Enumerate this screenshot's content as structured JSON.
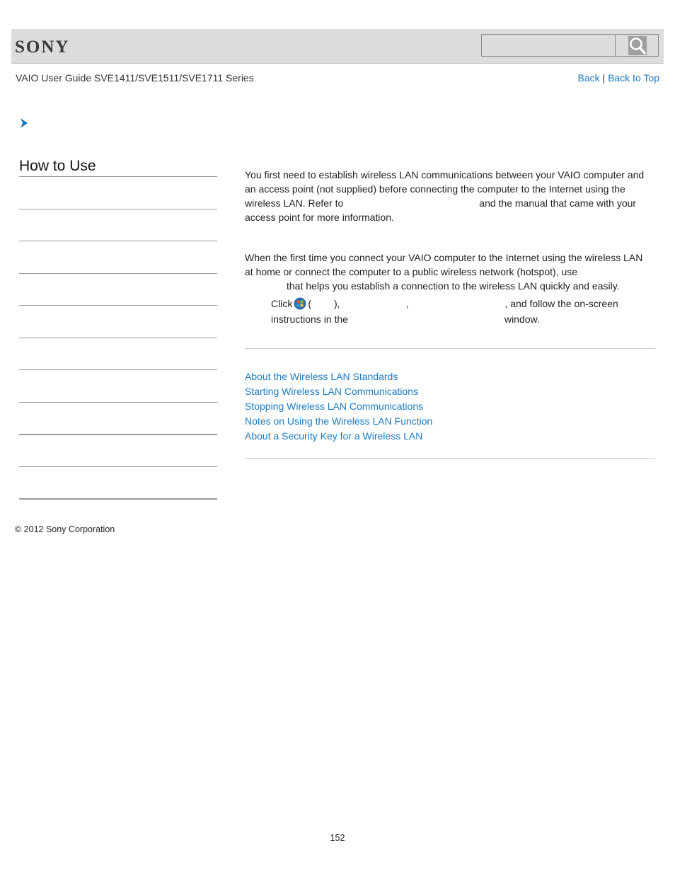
{
  "header": {
    "logo": "SONY",
    "search": {
      "placeholder": "",
      "value": ""
    }
  },
  "guide_title": "VAIO User Guide SVE1411/SVE1511/SVE1711 Series",
  "nav": {
    "back": "Back",
    "separator": "|",
    "back_to_top": "Back to Top"
  },
  "sidebar": {
    "title": "How to Use"
  },
  "content": {
    "para1_line1": "You first need to establish wireless LAN communications between your VAIO computer and",
    "para1_line2": "an access point (not supplied) before connecting the computer to the Internet using the",
    "para1_line3a": "wireless LAN. Refer to",
    "para1_line3b": "and the manual that came with your",
    "para1_line4": "access point for more information.",
    "para2_line1": "When the first time you connect your VAIO computer to the Internet using the wireless LAN",
    "para2_line2": "at home or connect the computer to a public wireless network (hotspot), use",
    "para2_line3": "that helps you establish a connection to the wireless LAN quickly and easily.",
    "step_click": "Click",
    "step_paren_open": "(",
    "step_paren_close": "),",
    "step_comma": ",",
    "step_follow": ", and follow the on-screen",
    "step_line2a": "instructions in the",
    "step_line2b": "window."
  },
  "related_links": [
    "About the Wireless LAN Standards",
    "Starting Wireless LAN Communications",
    "Stopping Wireless LAN Communications",
    "Notes on Using the Wireless LAN Function",
    "About a Security Key for a Wireless LAN"
  ],
  "footer": {
    "copyright": "© 2012 Sony Corporation",
    "page_number": "152"
  },
  "colors": {
    "link": "#1a7ac4",
    "header_bg": "#dcdcdc"
  }
}
